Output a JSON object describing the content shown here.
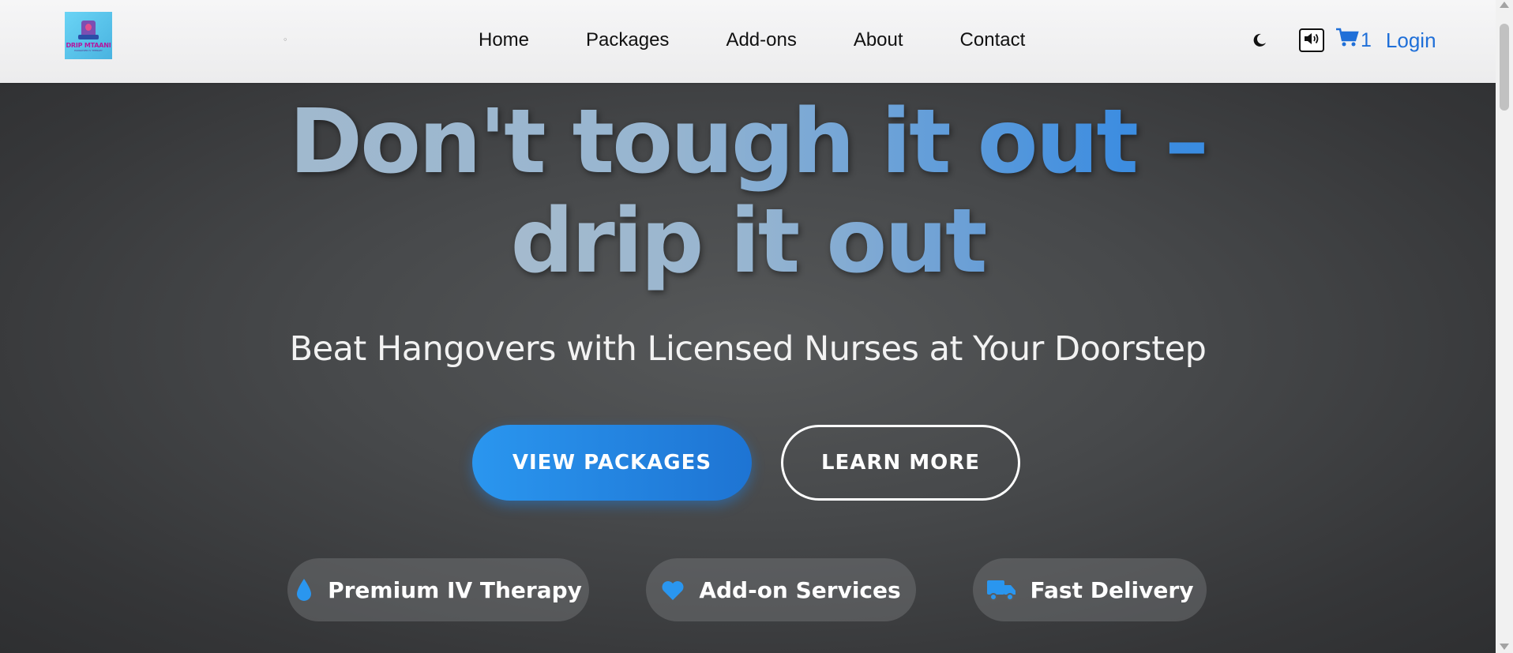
{
  "nav": {
    "logo_text": "DRIP MTAANI",
    "logo_tagline": "HANGOVER IV THERAPY",
    "links": [
      "Home",
      "Packages",
      "Add-ons",
      "About",
      "Contact"
    ],
    "cart_count": "1",
    "login_label": "Login",
    "icons": {
      "theme": "moon-icon",
      "sound": "speaker-icon",
      "cart": "cart-icon"
    }
  },
  "hero": {
    "headline_line1": "Don't tough it out –",
    "headline_line2": "drip it out",
    "subheading": "Beat Hangovers with Licensed Nurses at Your Doorstep",
    "primary_button": "VIEW PACKAGES",
    "secondary_button": "LEARN MORE",
    "features": [
      {
        "label": "Premium IV Therapy",
        "icon": "droplet-icon"
      },
      {
        "label": "Add-on Services",
        "icon": "heart-icon"
      },
      {
        "label": "Fast Delivery",
        "icon": "truck-icon"
      }
    ]
  },
  "colors": {
    "accent": "#1f6fd8",
    "button_blue": "#2a96ef",
    "hero_bg": "#47494b"
  }
}
